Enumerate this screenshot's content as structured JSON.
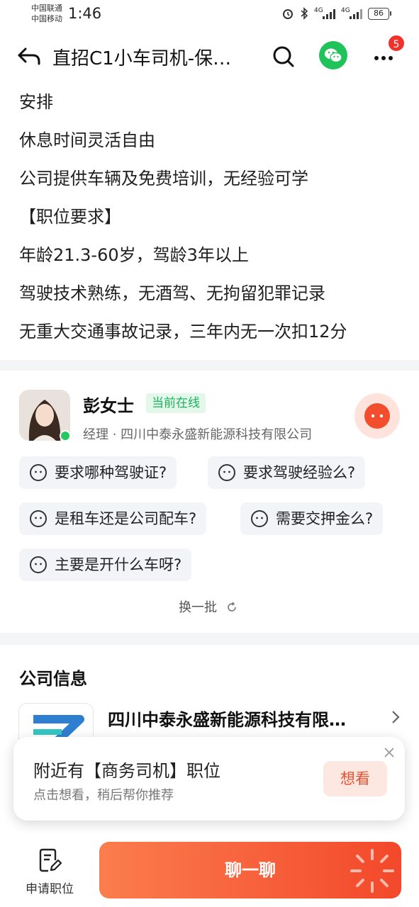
{
  "status_bar": {
    "carrier1": "中国联通",
    "carrier2": "中国移动",
    "time": "1:46",
    "signal1": "4G",
    "signal2": "4G",
    "battery": "86"
  },
  "nav": {
    "title": "直招C1小车司机-保…",
    "badge_count": "5"
  },
  "description": {
    "lines": [
      "安排",
      "休息时间灵活自由",
      "公司提供车辆及免费培训，无经验可学",
      "【职位要求】",
      "年龄21.3-60岁，驾龄3年以上",
      "驾驶技术熟练，无酒驾、无拘留犯罪记录",
      "无重大交通事故记录，三年内无一次扣12分"
    ]
  },
  "recruiter": {
    "name": "彭女士",
    "status": "当前在线",
    "info": "经理 · 四川中泰永盛新能源科技有限公司",
    "questions": [
      "要求哪种驾驶证?",
      "要求驾驶经验么?",
      "是租车还是公司配车?",
      "需要交押金么?",
      "主要是开什么车呀?"
    ],
    "refresh_label": "换一批"
  },
  "company": {
    "section_title": "公司信息",
    "name": "四川中泰永盛新能源科技有限…"
  },
  "popup": {
    "title": "附近有【商务司机】职位",
    "subtitle": "点击想看，稍后帮你推荐",
    "button": "想看"
  },
  "bottom": {
    "apply_label": "申请职位",
    "chat_label": "聊一聊"
  },
  "colors": {
    "accent": "#f3482b",
    "online": "#27c761",
    "wechat": "#1fc35a"
  }
}
